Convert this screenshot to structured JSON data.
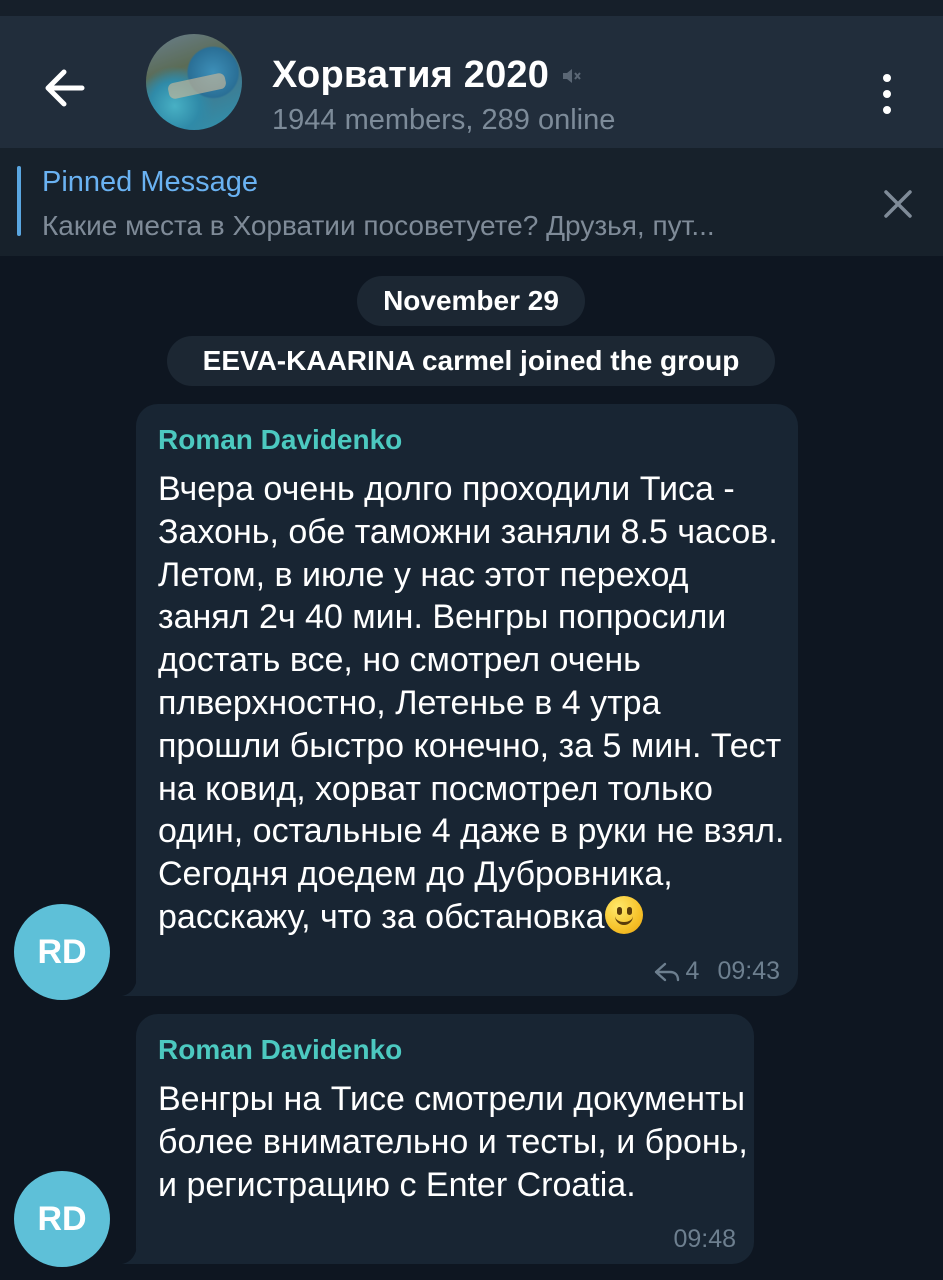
{
  "header": {
    "back_icon": "arrow-left-icon",
    "title": "Хорватия 2020",
    "muted_icon": "muted-speaker-icon",
    "subtitle": "1944 members, 289 online",
    "menu_icon": "more-vertical-icon"
  },
  "pinned": {
    "title": "Pinned Message",
    "text": "Какие места в Хорватии посоветуете?  Друзья, пут...",
    "close_icon": "close-icon"
  },
  "service": {
    "date": "November 29",
    "joined": "EEVA-KAARINA carmel joined the group"
  },
  "messages": [
    {
      "sender": "Roman Davidenko",
      "avatar_initials": "RD",
      "text": "Вчера очень долго проходили Тиса - Захонь, обе таможни заняли 8.5 часов. Летом, в июле у нас этот переход занял 2ч 40 мин. Венгры попросили достать все, но смотрел очень плверхностно, Летенье в 4 утра прошли быстро конечно, за 5 мин. Тест на ковид, хорват посмотрел только один, остальные 4 даже в руки не взял. Сегодня доедем до Дубровника, расскажу, что за обстановка",
      "emoji_icon": "slightly-smiling-face-icon",
      "replies": "4",
      "time": "09:43"
    },
    {
      "sender": "Roman Davidenko",
      "avatar_initials": "RD",
      "text": "Венгры на Тисе смотрели документы более внимательно и тесты, и бронь, и регистрацию с Enter Croatia.",
      "time": "09:48"
    }
  ],
  "colors": {
    "background": "#0e1621",
    "header": "#212d3b",
    "bubble": "#182533",
    "sender_name": "#4cc9c0",
    "accent": "#6ab2f2",
    "avatar": "#5ec0d8"
  }
}
